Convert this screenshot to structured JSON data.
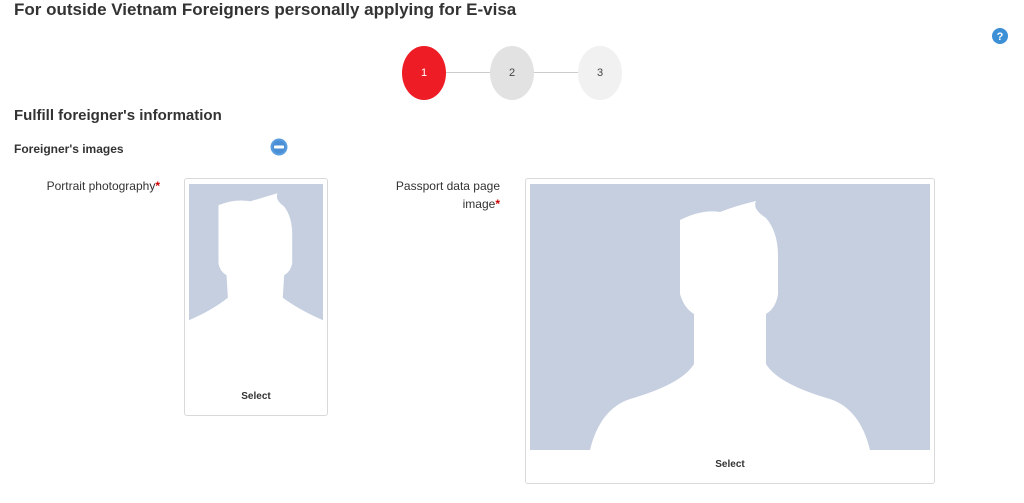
{
  "header": {
    "title": "For outside Vietnam Foreigners personally applying for E-visa"
  },
  "help": {
    "icon": "help-icon",
    "color": "#3d8fd6"
  },
  "stepper": {
    "active_color": "#ee1c24",
    "steps": [
      {
        "label": "1",
        "state": "active"
      },
      {
        "label": "2",
        "state": "inactive"
      },
      {
        "label": "3",
        "state": "inactive"
      }
    ]
  },
  "form": {
    "section_title": "Fulfill foreigner's information",
    "images_section": {
      "title": "Foreigner's images",
      "collapse_icon": "minus-circle-icon",
      "portrait": {
        "label": "Portrait photography",
        "required_mark": "*",
        "select_label": "Select"
      },
      "passport": {
        "label_line1": "Passport data page",
        "label_line2": "image",
        "required_mark": "*",
        "select_label": "Select"
      }
    }
  },
  "colors": {
    "placeholder_bg": "#c5cfe0",
    "silhouette": "#ffffff"
  }
}
